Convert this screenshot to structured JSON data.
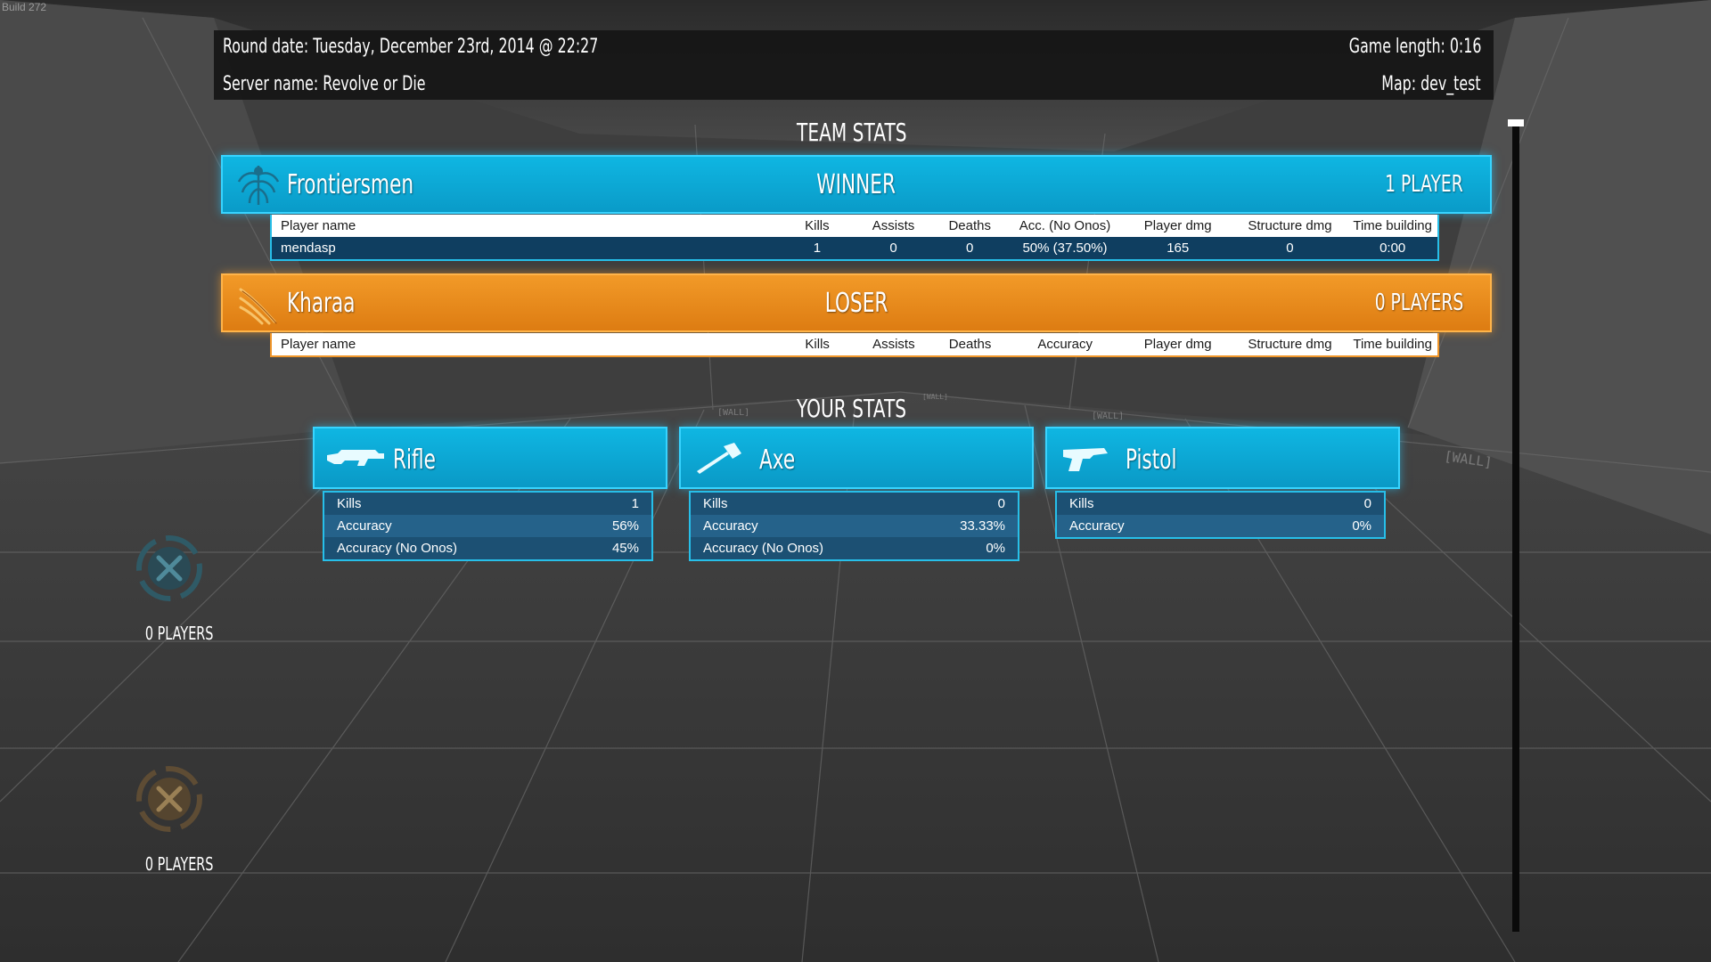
{
  "build": "Build 272",
  "info": {
    "round_date": "Round date: Tuesday, December 23rd, 2014 @ 22:27",
    "server_name": "Server name: Revolve or Die",
    "game_length": "Game length: 0:16",
    "map": "Map: dev_test"
  },
  "team_stats_title": "TEAM STATS",
  "your_stats_title": "YOUR STATS",
  "colors": {
    "marine": "#0fb6e2",
    "alien": "#f29a28",
    "table_row": "#0f3e60"
  },
  "teams": [
    {
      "name": "Frontiersmen",
      "result": "WINNER",
      "count": "1 PLAYER",
      "icon": "frontiersmen-icon",
      "columns": [
        "Player name",
        "Kills",
        "Assists",
        "Deaths",
        "Acc. (No Onos)",
        "Player dmg",
        "Structure dmg",
        "Time building"
      ],
      "rows": [
        [
          "mendasp",
          "1",
          "0",
          "0",
          "50% (37.50%)",
          "165",
          "0",
          "0:00"
        ]
      ]
    },
    {
      "name": "Kharaa",
      "result": "LOSER",
      "count": "0 PLAYERS",
      "icon": "kharaa-claw-icon",
      "columns": [
        "Player name",
        "Kills",
        "Assists",
        "Deaths",
        "Accuracy",
        "Player dmg",
        "Structure dmg",
        "Time building"
      ],
      "rows": []
    }
  ],
  "weapons": [
    {
      "name": "Rifle",
      "icon": "rifle-icon",
      "stats": [
        {
          "label": "Kills",
          "value": "1"
        },
        {
          "label": "Accuracy",
          "value": "56%"
        },
        {
          "label": "Accuracy (No Onos)",
          "value": "45%"
        }
      ]
    },
    {
      "name": "Axe",
      "icon": "axe-icon",
      "stats": [
        {
          "label": "Kills",
          "value": "0"
        },
        {
          "label": "Accuracy",
          "value": "33.33%"
        },
        {
          "label": "Accuracy (No Onos)",
          "value": "0%"
        }
      ]
    },
    {
      "name": "Pistol",
      "icon": "pistol-icon",
      "stats": [
        {
          "label": "Kills",
          "value": "0"
        },
        {
          "label": "Accuracy",
          "value": "0%"
        }
      ]
    }
  ],
  "side_groups": [
    {
      "icon": "ready-room-icon",
      "count": "0 PLAYERS"
    },
    {
      "icon": "spectator-icon",
      "count": "0 PLAYERS"
    }
  ]
}
